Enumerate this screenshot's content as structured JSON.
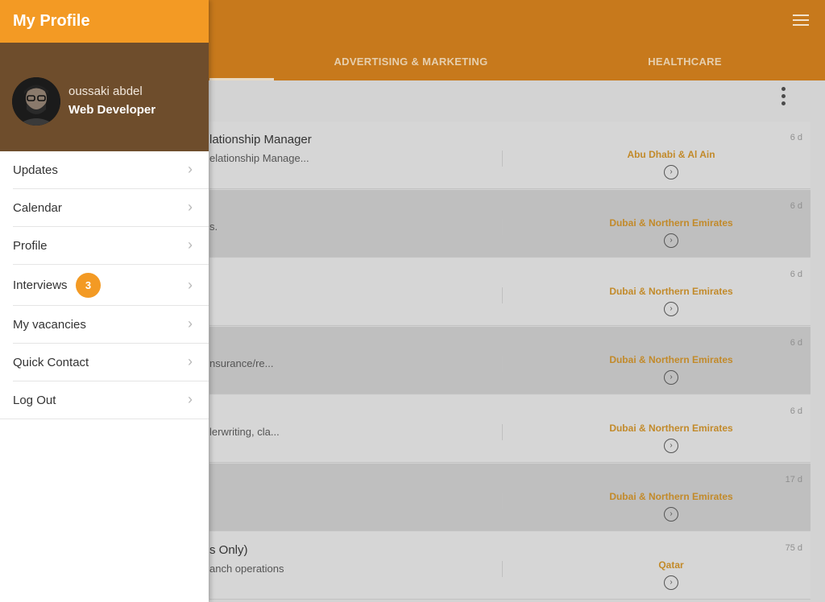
{
  "header": {
    "menu_icon": "hamburger-icon"
  },
  "tabs": [
    {
      "label": ""
    },
    {
      "label": "ADVERTISING & MARKETING"
    },
    {
      "label": "HEALTHCARE"
    }
  ],
  "toolbar": {
    "more_icon": "more-vertical-icon"
  },
  "jobs": [
    {
      "title": "lationship Manager",
      "snippet": "elationship Manage...",
      "location": "Abu Dhabi & Al Ain",
      "age": "6 d"
    },
    {
      "title": "",
      "snippet": "s.",
      "location": "Dubai & Northern Emirates",
      "age": "6 d"
    },
    {
      "title": "",
      "snippet": "",
      "location": "Dubai & Northern Emirates",
      "age": "6 d"
    },
    {
      "title": "",
      "snippet": "nsurance/re...",
      "location": "Dubai & Northern Emirates",
      "age": "6 d"
    },
    {
      "title": "",
      "snippet": "lerwriting, cla...",
      "location": "Dubai & Northern Emirates",
      "age": "6 d"
    },
    {
      "title": "",
      "snippet": "",
      "location": "Dubai & Northern Emirates",
      "age": "17 d"
    },
    {
      "title": "s Only)",
      "snippet": "anch operations",
      "location": "Qatar",
      "age": "75 d"
    }
  ],
  "drawer": {
    "title": "My Profile",
    "user": {
      "name": "oussaki abdel",
      "role": "Web Developer"
    },
    "menu": [
      {
        "label": "Updates"
      },
      {
        "label": "Calendar"
      },
      {
        "label": "Profile"
      },
      {
        "label": "Interviews",
        "badge": "3"
      },
      {
        "label": "My vacancies"
      },
      {
        "label": "Quick Contact"
      },
      {
        "label": "Log Out"
      }
    ]
  },
  "colors": {
    "accent": "#f39a24",
    "topbar": "#c7791c",
    "user_panel": "#6e4d2c",
    "location_text": "#c28a2a"
  }
}
